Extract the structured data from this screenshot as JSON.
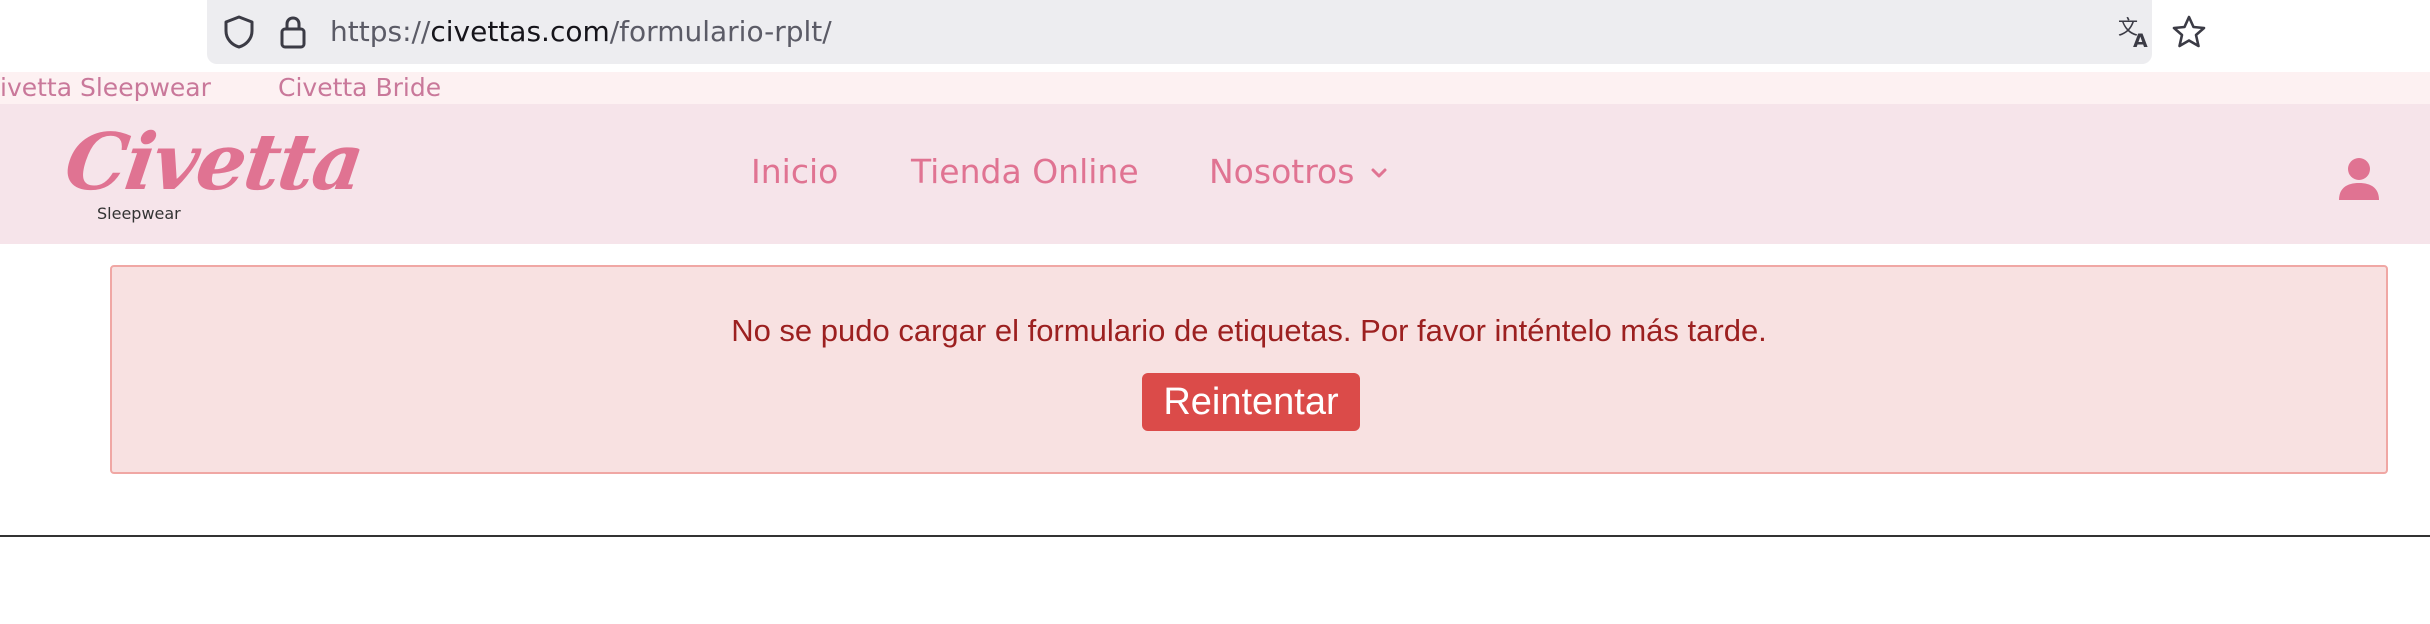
{
  "browser": {
    "url_scheme": "https://",
    "url_host": "civettas.com",
    "url_path": "/formulario-rplt/",
    "icons": [
      "shield-icon",
      "lock-icon",
      "translate-icon",
      "bookmark-star-icon"
    ]
  },
  "topbar": {
    "links": [
      "ivetta Sleepwear",
      "Civetta Bride"
    ]
  },
  "header": {
    "logo_text": "Civetta",
    "logo_subtitle": "Sleepwear",
    "nav": [
      {
        "label": "Inicio"
      },
      {
        "label": "Tienda Online"
      },
      {
        "label": "Nosotros",
        "has_dropdown": true
      }
    ],
    "account_icon": "user-icon"
  },
  "alert": {
    "message": "No se pudo cargar el formulario de etiquetas. Por favor inténtelo más tarde.",
    "retry_label": "Reintentar"
  },
  "colors": {
    "brand_pink": "#e07392",
    "header_bg": "#f6e4ea",
    "alert_bg": "#f8e1e1",
    "alert_text": "#9c2020",
    "button_bg": "#db4b49"
  }
}
